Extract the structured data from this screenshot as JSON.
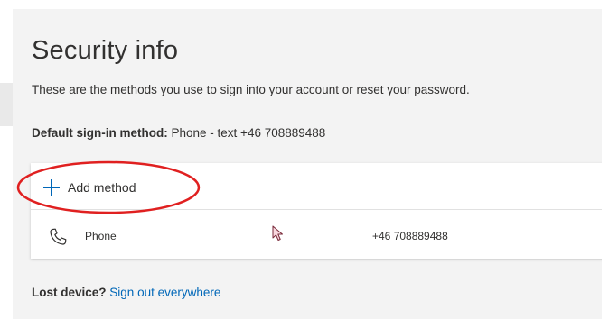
{
  "page": {
    "title": "Security info",
    "subtitle": "These are the methods you use to sign into your account or reset your password."
  },
  "default_method": {
    "label": "Default sign-in method:",
    "value": "Phone - text +46 708889488"
  },
  "methods_card": {
    "add_label": "Add method",
    "add_icon": "plus-icon",
    "rows": [
      {
        "icon": "phone-icon",
        "name": "Phone",
        "value": "+46 708889488"
      }
    ]
  },
  "footer": {
    "lost_label": "Lost device?",
    "signout_link": "Sign out everywhere"
  },
  "colors": {
    "accent": "#0067b8",
    "highlight": "#e02020",
    "background": "#f3f3f3"
  }
}
